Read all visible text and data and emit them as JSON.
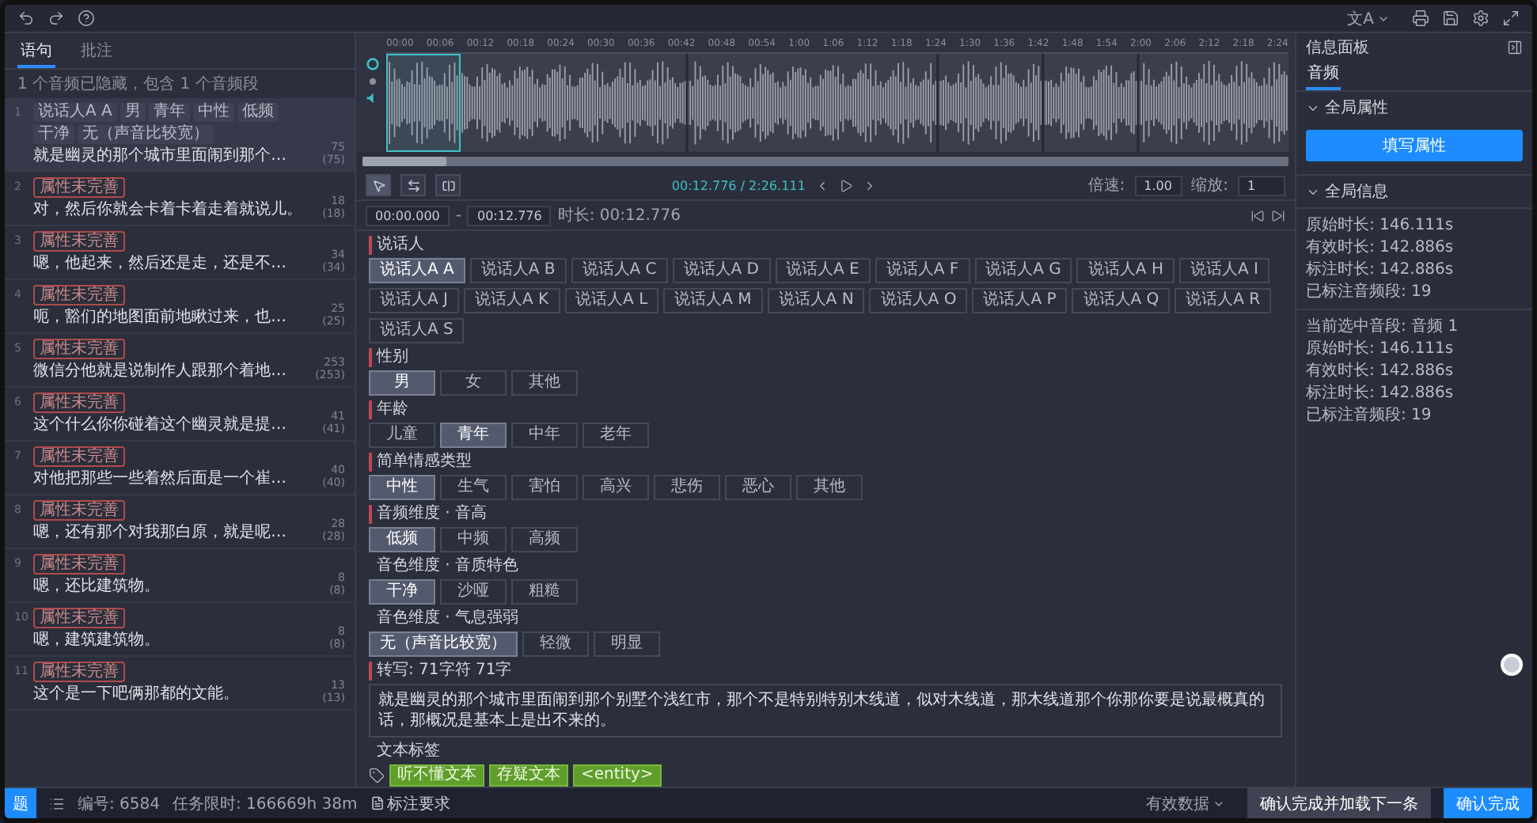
{
  "toolbar": {
    "language": "文A"
  },
  "left_panel": {
    "tabs": [
      {
        "label": "语句",
        "selected": true
      },
      {
        "label": "批注",
        "selected": false
      }
    ],
    "hint": "1 个音频已隐藏，包含 1 个音频段",
    "items": [
      {
        "index": "1",
        "tags": [
          "说话人A A",
          "男",
          "青年",
          "中性",
          "低频",
          "干净",
          "无（声音比较宽）"
        ],
        "text": "就是幽灵的那个城市里面闹到那个…",
        "count": "75",
        "total": "(75)",
        "selected": true
      },
      {
        "index": "2",
        "status": "属性未完善",
        "text": "对，然后你就会卡着卡着走着就说儿。",
        "count": "18",
        "total": "(18)",
        "selected": false
      },
      {
        "index": "3",
        "status": "属性未完善",
        "text": "嗯，他起来，然后还是走，还是不…",
        "count": "34",
        "total": "(34)",
        "selected": false
      },
      {
        "index": "4",
        "status": "属性未完善",
        "text": "呃，豁们的地图面前地瞅过来，也…",
        "count": "25",
        "total": "(25)",
        "selected": false
      },
      {
        "index": "5",
        "status": "属性未完善",
        "text": "微信分他就是说制作人跟那个着地…",
        "count": "253",
        "total": "(253)",
        "selected": false
      },
      {
        "index": "6",
        "status": "属性未完善",
        "text": "这个什么你你碰着这个幽灵就是提…",
        "count": "41",
        "total": "(41)",
        "selected": false
      },
      {
        "index": "7",
        "status": "属性未完善",
        "text": "对他把那些一些着然后面是一个崔…",
        "count": "40",
        "total": "(40)",
        "selected": false
      },
      {
        "index": "8",
        "status": "属性未完善",
        "text": "嗯，还有那个对我那白原，就是呢…",
        "count": "28",
        "total": "(28)",
        "selected": false
      },
      {
        "index": "9",
        "status": "属性未完善",
        "text": "嗯，还比建筑物。",
        "count": "8",
        "total": "(8)",
        "selected": false
      },
      {
        "index": "10",
        "status": "属性未完善",
        "text": "嗯，建筑建筑物。",
        "count": "8",
        "total": "(8)",
        "selected": false
      },
      {
        "index": "11",
        "status": "属性未完善",
        "text": "这个是一下吧俩那都的文能。",
        "count": "13",
        "total": "(13)",
        "selected": false
      }
    ]
  },
  "waveform": {
    "ticks": [
      "00:00",
      "00:06",
      "00:12",
      "00:18",
      "00:24",
      "00:30",
      "00:36",
      "00:42",
      "00:48",
      "00:54",
      "1:00",
      "1:06",
      "1:12",
      "1:18",
      "1:24",
      "1:30",
      "1:36",
      "1:42",
      "1:48",
      "1:54",
      "2:00",
      "2:06",
      "2:12",
      "2:18",
      "2:24"
    ]
  },
  "player": {
    "tools": [
      {
        "kind": "select",
        "selected": true
      },
      {
        "kind": "swap",
        "selected": false
      },
      {
        "kind": "split",
        "selected": false
      }
    ],
    "time": "00:12.776 / 2:26.111",
    "speed_label": "倍速:",
    "speed": "1.00",
    "zoom_label": "缩放:",
    "zoom": "1"
  },
  "segment": {
    "start": "00:00.000",
    "dash": "-",
    "end": "00:12.776",
    "duration": "时长: 00:12.776"
  },
  "groups": [
    {
      "label": "说话人",
      "required": true,
      "options": [
        {
          "label": "说话人A A",
          "selected": true
        },
        {
          "label": "说话人A B",
          "selected": false
        },
        {
          "label": "说话人A C",
          "selected": false
        },
        {
          "label": "说话人A D",
          "selected": false
        },
        {
          "label": "说话人A E",
          "selected": false
        },
        {
          "label": "说话人A F",
          "selected": false
        },
        {
          "label": "说话人A G",
          "selected": false
        },
        {
          "label": "说话人A H",
          "selected": false
        },
        {
          "label": "说话人A I",
          "selected": false
        },
        {
          "label": "说话人A J",
          "selected": false
        },
        {
          "label": "说话人A K",
          "selected": false
        },
        {
          "label": "说话人A L",
          "selected": false
        },
        {
          "label": "说话人A M",
          "selected": false
        },
        {
          "label": "说话人A N",
          "selected": false
        },
        {
          "label": "说话人A O",
          "selected": false
        },
        {
          "label": "说话人A P",
          "selected": false
        },
        {
          "label": "说话人A Q",
          "selected": false
        },
        {
          "label": "说话人A R",
          "selected": false
        },
        {
          "label": "说话人A S",
          "selected": false
        }
      ]
    },
    {
      "label": "性别",
      "required": true,
      "options": [
        {
          "label": "男",
          "selected": true
        },
        {
          "label": "女",
          "selected": false
        },
        {
          "label": "其他",
          "selected": false
        }
      ]
    },
    {
      "label": "年龄",
      "required": true,
      "options": [
        {
          "label": "儿童",
          "selected": false
        },
        {
          "label": "青年",
          "selected": true
        },
        {
          "label": "中年",
          "selected": false
        },
        {
          "label": "老年",
          "selected": false
        }
      ]
    },
    {
      "label": "简单情感类型",
      "required": true,
      "options": [
        {
          "label": "中性",
          "selected": true
        },
        {
          "label": "生气",
          "selected": false
        },
        {
          "label": "害怕",
          "selected": false
        },
        {
          "label": "高兴",
          "selected": false
        },
        {
          "label": "悲伤",
          "selected": false
        },
        {
          "label": "恶心",
          "selected": false
        },
        {
          "label": "其他",
          "selected": false
        }
      ]
    },
    {
      "label": "音频维度 · 音高",
      "required": true,
      "options": [
        {
          "label": "低频",
          "selected": true
        },
        {
          "label": "中频",
          "selected": false
        },
        {
          "label": "高频",
          "selected": false
        }
      ]
    },
    {
      "label": "音色维度 · 音质特色",
      "required": false,
      "options": [
        {
          "label": "干净",
          "selected": true
        },
        {
          "label": "沙哑",
          "selected": false
        },
        {
          "label": "粗糙",
          "selected": false
        }
      ]
    },
    {
      "label": "音色维度 · 气息强弱",
      "required": false,
      "options": [
        {
          "label": "无（声音比较宽）",
          "selected": true
        },
        {
          "label": "轻微",
          "selected": false
        },
        {
          "label": "明显",
          "selected": false
        }
      ]
    }
  ],
  "transcription": {
    "label": "转写: 71字符 71字",
    "value": "就是幽灵的那个城市里面闹到那个别墅个浅红市，那个不是特别特别木线道，似对木线道，那木线道那个你那你要是说最概真的话，那概况是基本上是出不来的。"
  },
  "text_labels": {
    "label": "文本标签",
    "chips": [
      "听不懂文本",
      "存疑文本",
      "<entity>"
    ]
  },
  "right_panel": {
    "title": "信息面板",
    "tab": "音频",
    "sections": [
      {
        "title": "全局属性",
        "expanded": true,
        "kind": "button",
        "button": "填写属性"
      },
      {
        "title": "全局信息",
        "expanded": true,
        "kind": "stats",
        "groups": [
          [
            "原始时长: 146.111s",
            "有效时长: 142.886s",
            "标注时长: 142.886s",
            "已标注音频段: 19"
          ],
          [
            "当前选中音段: 音频 1",
            "原始时长: 146.111s",
            "有效时长: 142.886s",
            "标注时长: 142.886s",
            "已标注音频段: 19"
          ]
        ]
      }
    ]
  },
  "bottom_bar": {
    "badge": "题",
    "id": "编号: 6584",
    "time_limit": "任务限时: 166669h 38m",
    "requirements": "标注要求",
    "valid": "有效数据",
    "next_button": "确认完成并加载下一条",
    "done_button": "确认完成"
  }
}
